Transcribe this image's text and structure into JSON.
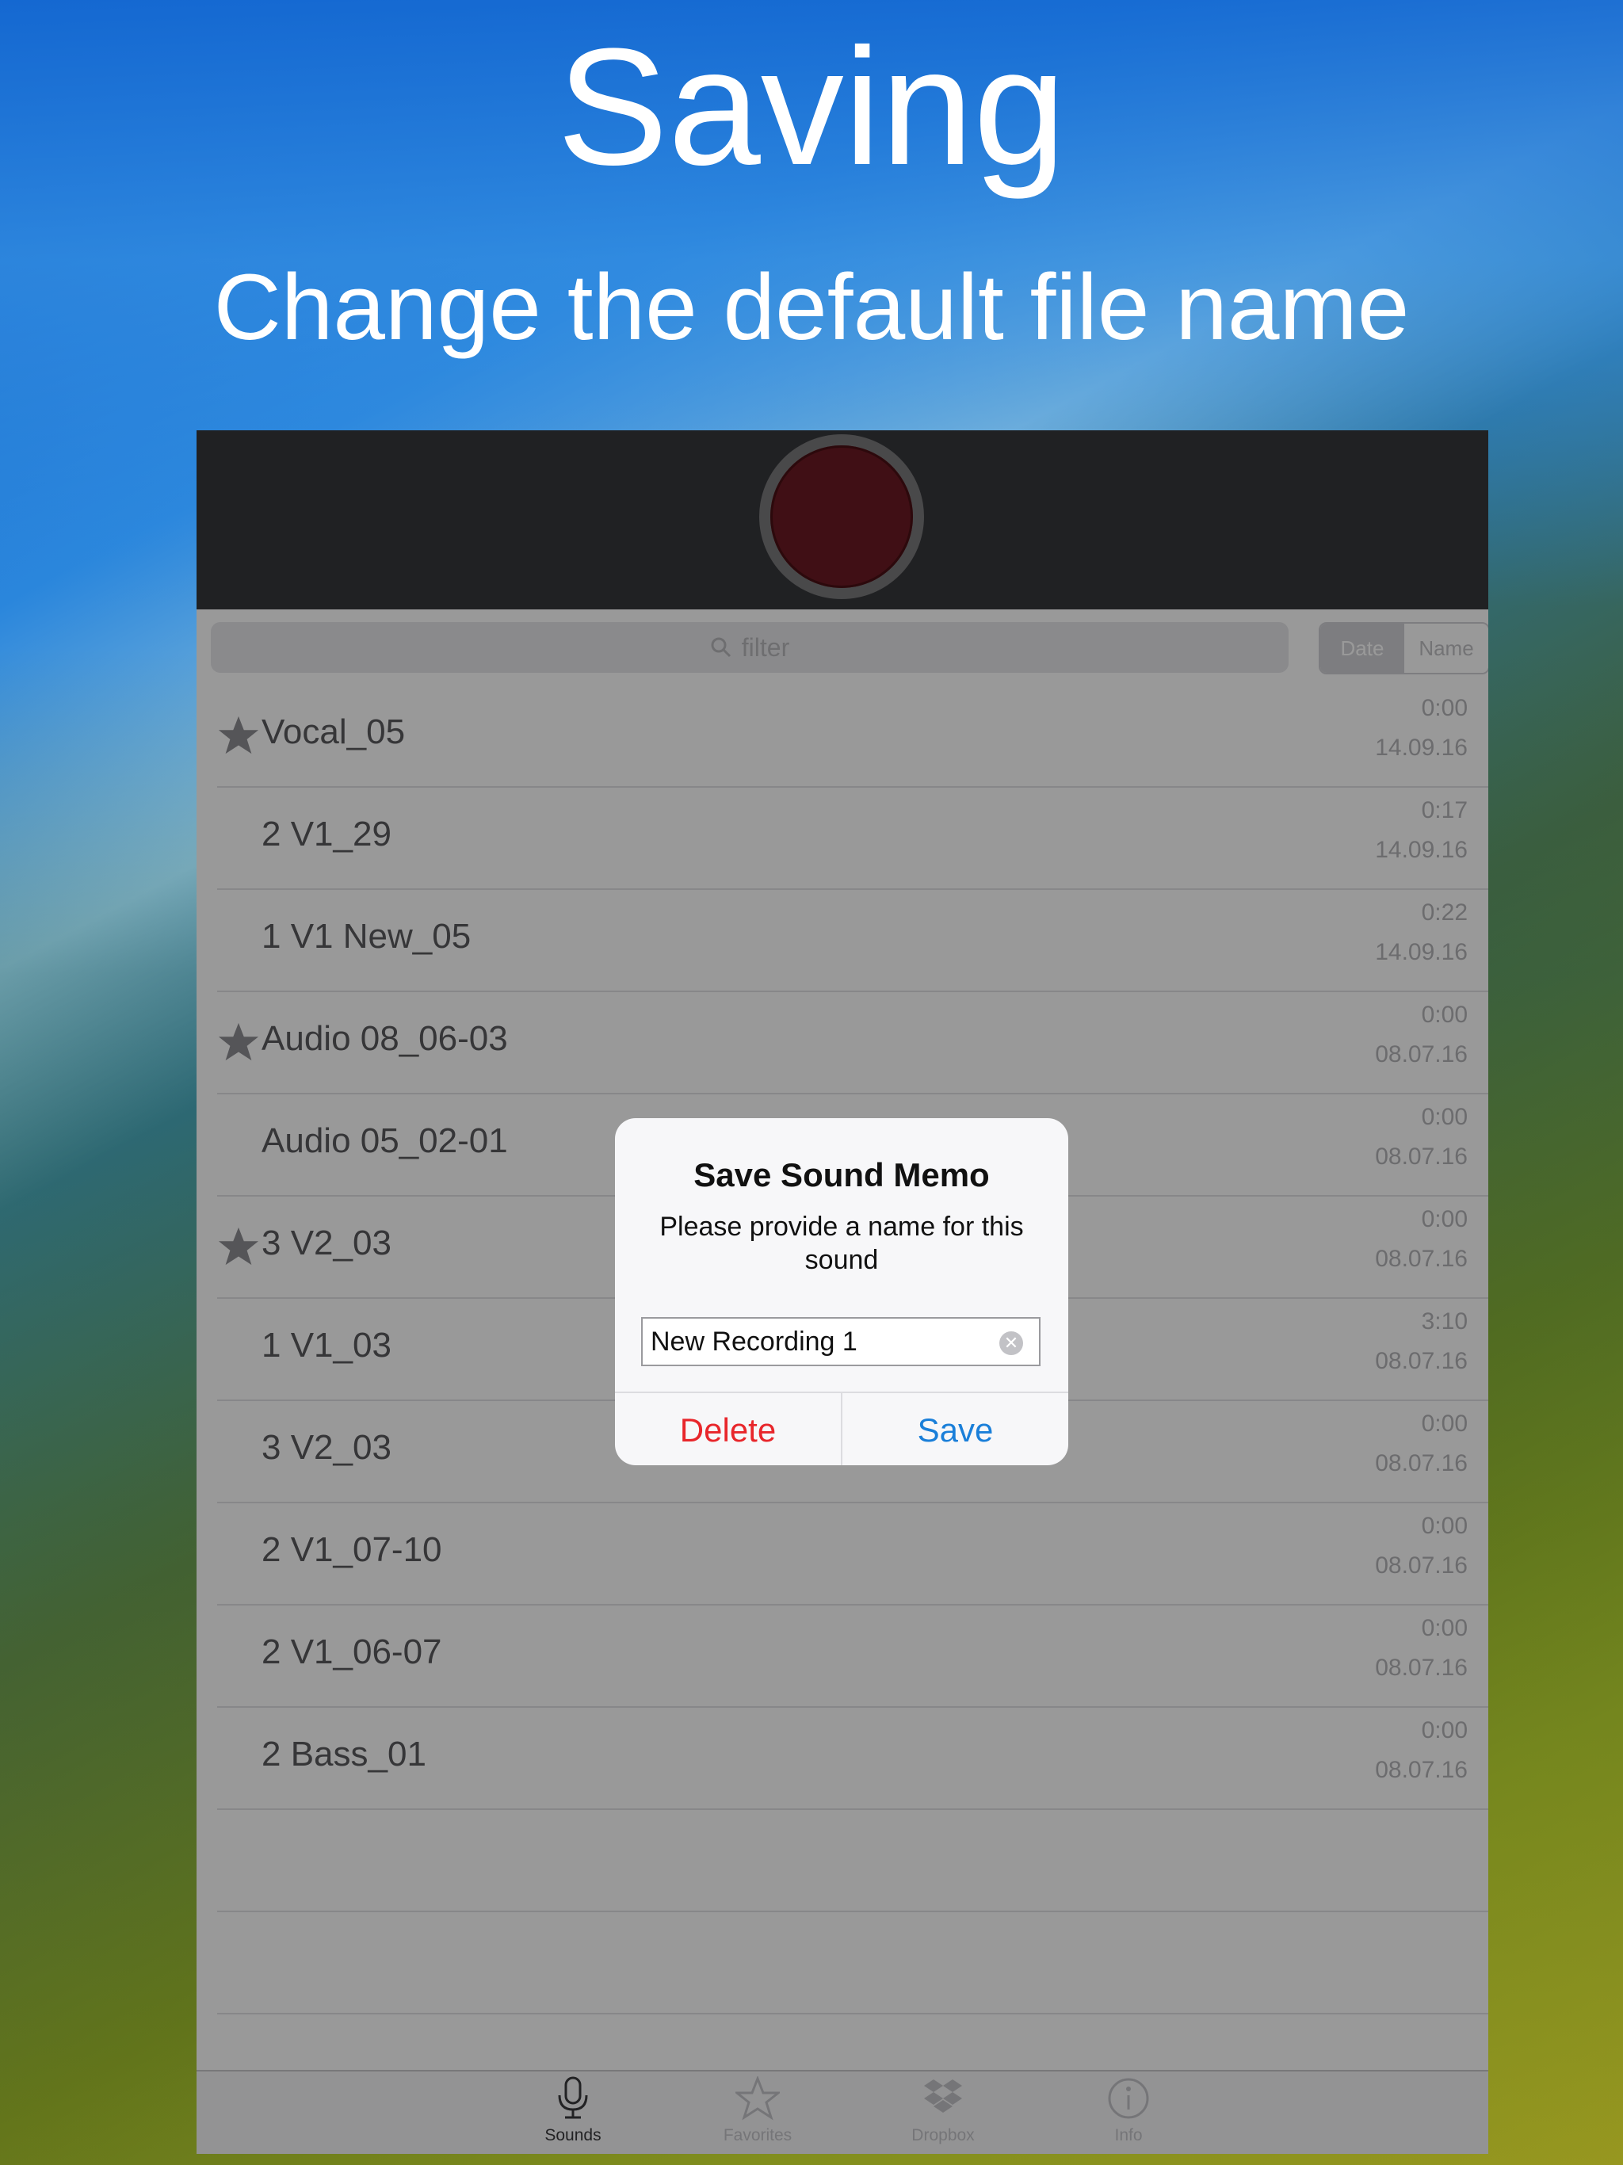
{
  "hero": {
    "title": "Saving",
    "subtitle": "Change the default file name"
  },
  "colors": {
    "record_button": "#6c1a23",
    "delete": "#e8262b",
    "save": "#1a7fd9"
  },
  "search": {
    "placeholder": "filter"
  },
  "sort": {
    "options": [
      "Date",
      "Name"
    ],
    "selected": "Date"
  },
  "recordings": [
    {
      "name": "Vocal_05",
      "duration": "0:00",
      "date": "14.09.16",
      "favorite": true
    },
    {
      "name": "2 V1_29",
      "duration": "0:17",
      "date": "14.09.16",
      "favorite": false
    },
    {
      "name": "1 V1 New_05",
      "duration": "0:22",
      "date": "14.09.16",
      "favorite": false
    },
    {
      "name": "Audio 08_06-03",
      "duration": "0:00",
      "date": "08.07.16",
      "favorite": true
    },
    {
      "name": "Audio 05_02-01",
      "duration": "0:00",
      "date": "08.07.16",
      "favorite": false
    },
    {
      "name": "3 V2_03",
      "duration": "0:00",
      "date": "08.07.16",
      "favorite": true
    },
    {
      "name": "1 V1_03",
      "duration": "3:10",
      "date": "08.07.16",
      "favorite": false
    },
    {
      "name": "3 V2_03",
      "duration": "0:00",
      "date": "08.07.16",
      "favorite": false
    },
    {
      "name": "2 V1_07-10",
      "duration": "0:00",
      "date": "08.07.16",
      "favorite": false
    },
    {
      "name": "2 V1_06-07",
      "duration": "0:00",
      "date": "08.07.16",
      "favorite": false
    },
    {
      "name": "2 Bass_01",
      "duration": "0:00",
      "date": "08.07.16",
      "favorite": false
    }
  ],
  "tabs": [
    {
      "label": "Sounds",
      "icon": "microphone-icon",
      "active": true
    },
    {
      "label": "Favorites",
      "icon": "star-icon",
      "active": false
    },
    {
      "label": "Dropbox",
      "icon": "dropbox-icon",
      "active": false
    },
    {
      "label": "Info",
      "icon": "info-icon",
      "active": false
    }
  ],
  "alert": {
    "title": "Save Sound Memo",
    "message": "Please provide a name for this sound",
    "input_value": "New Recording 1",
    "delete_label": "Delete",
    "save_label": "Save"
  }
}
